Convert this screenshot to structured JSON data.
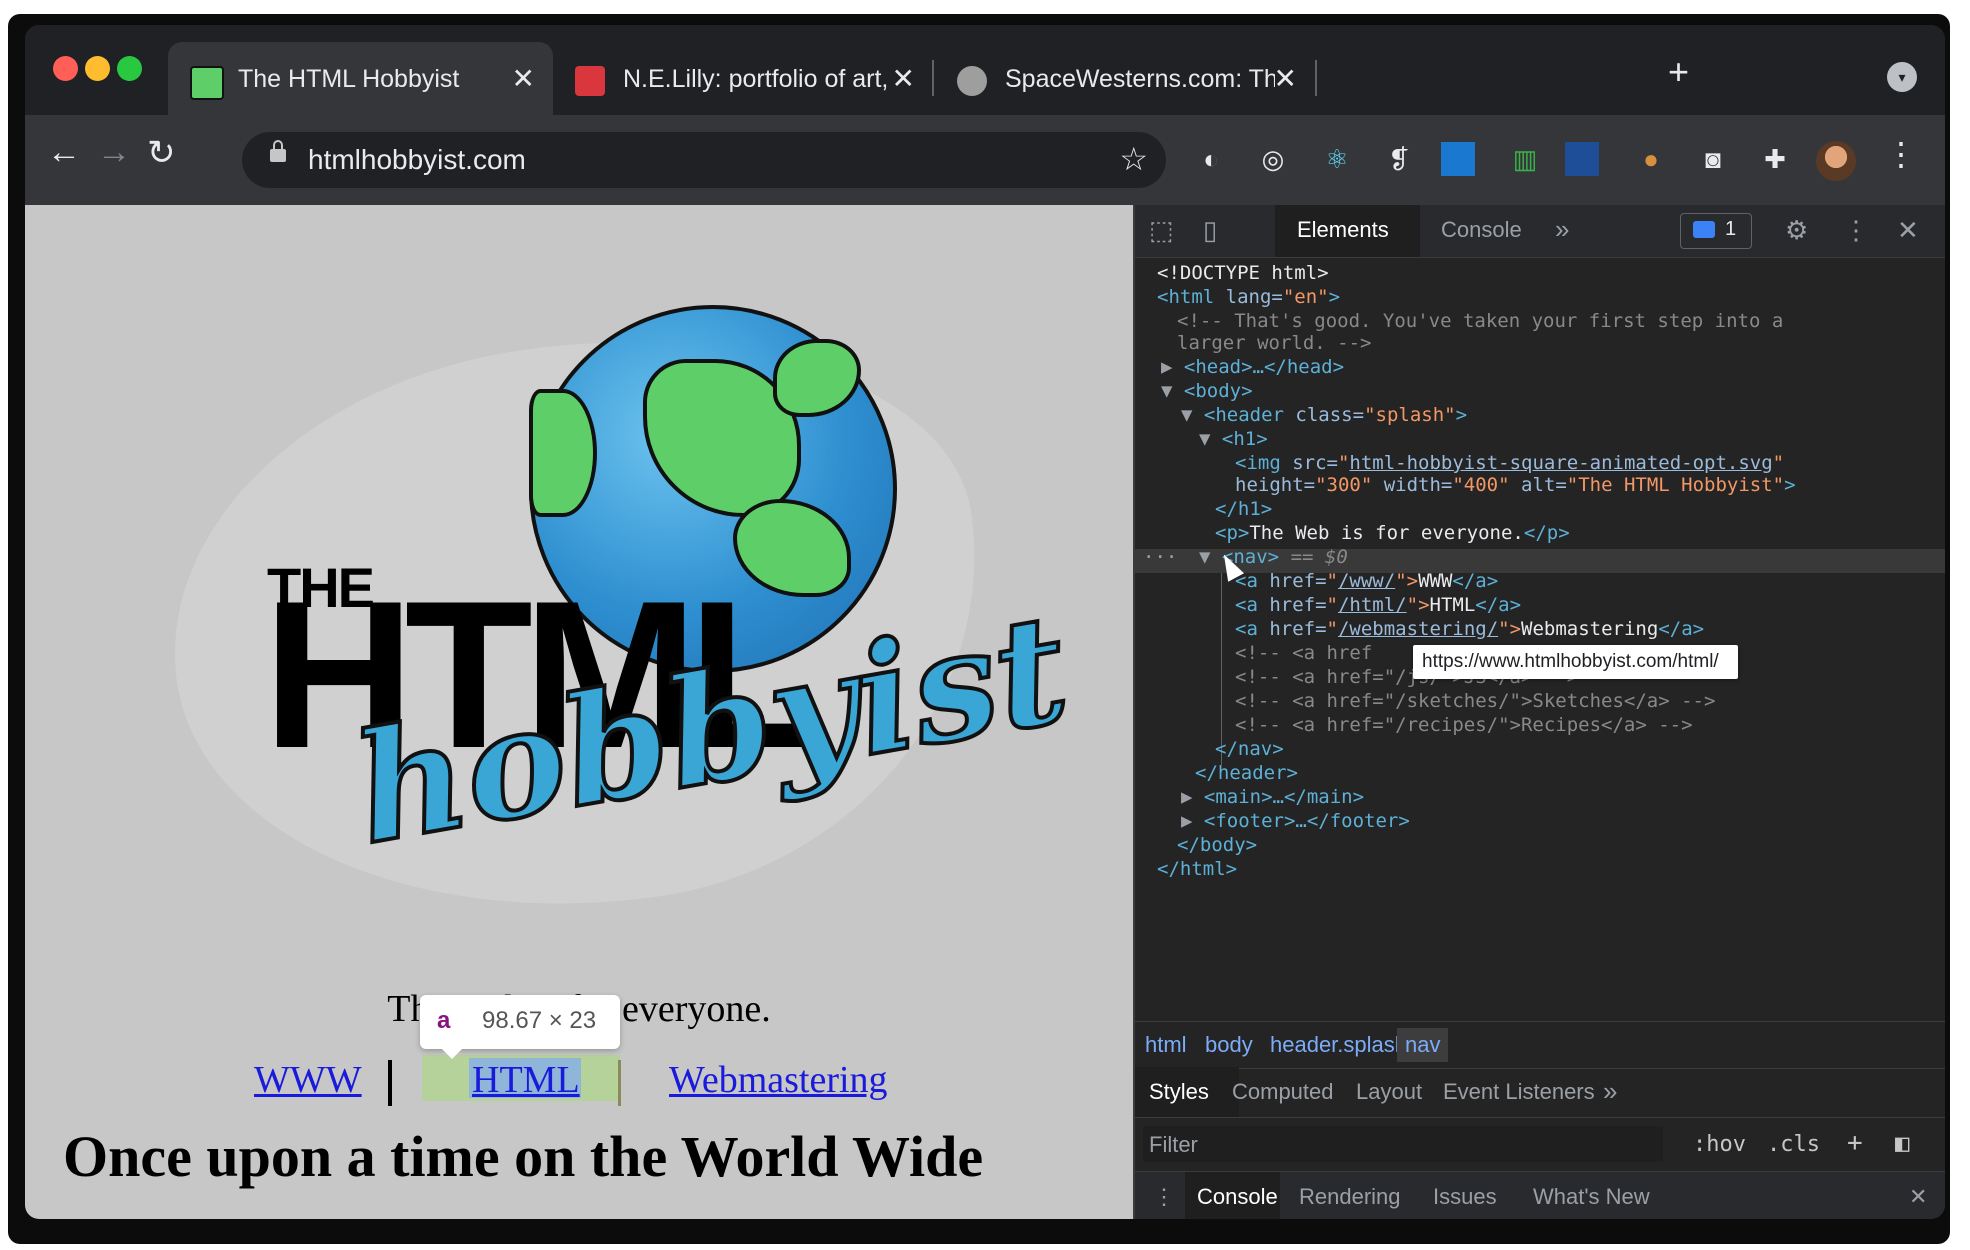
{
  "browser": {
    "tabs": [
      {
        "title": "The HTML Hobbyist",
        "active": true
      },
      {
        "title": "N.E.Lilly: portfolio of art, development",
        "active": false
      },
      {
        "title": "SpaceWesterns.com: The e-zine",
        "active": false
      }
    ],
    "new_tab": "+",
    "tab_close": "✕",
    "url": "htmlhobbyist.com"
  },
  "page": {
    "tagline": "The Web is for everyone.",
    "tooltip_tag": "a",
    "tooltip_dims": "98.67 × 23",
    "nav_links": [
      "WWW",
      "HTML",
      "Webmastering"
    ],
    "heading": "Once upon a time on the World Wide"
  },
  "devtools": {
    "tabs": [
      "Elements",
      "Console"
    ],
    "more": "»",
    "issues_count": "1",
    "selected_marker": "== $0",
    "url_tooltip": "https://www.htmlhobbyist.com/html/",
    "breadcrumbs": [
      "html",
      "body",
      "header.splash",
      "nav"
    ],
    "style_tabs": [
      "Styles",
      "Computed",
      "Layout",
      "Event Listeners"
    ],
    "filter_placeholder": "Filter",
    "hov": ":hov",
    "cls": ".cls",
    "drawer_tabs": [
      "Console",
      "Rendering",
      "Issues",
      "What's New"
    ],
    "dom": {
      "l1": "<!DOCTYPE html>",
      "l2_tag": "<html ",
      "l2_attr": "lang=",
      "l2_val": "\"en\"",
      "l2_end": ">",
      "l3": "<!-- That's good. You've taken your first step into a",
      "l4": "larger world. -->",
      "l5": "<head>…</head>",
      "l6": "<body>",
      "l7_tag": "<header ",
      "l7_attr": "class=",
      "l7_val": "\"splash\"",
      "l7_end": ">",
      "l8": "<h1>",
      "l9_tag": "<img ",
      "l9_attr": "src=",
      "l9_q1": "\"",
      "l9_link": "html-hobbyist-square-animated-opt.svg",
      "l9_q2": "\"",
      "l10_a1": "height=",
      "l10_v1": "\"300\"",
      "l10_a2": " width=",
      "l10_v2": "\"400\"",
      "l10_a3": " alt=",
      "l10_v3": "\"The HTML Hobbyist\"",
      "l10_end": ">",
      "l11": "</h1>",
      "l12_open": "<p>",
      "l12_text": "The Web is for everyone.",
      "l12_close": "</p>",
      "l13": "<nav>",
      "l14_open": "<a ",
      "l14_attr": "href=",
      "l14_q1": "\"",
      "l14_link": "/www/",
      "l14_q2": "\">",
      "l14_text": "WWW",
      "l14_close": "</a>",
      "l15_link": "/html/",
      "l15_text": "HTML",
      "l16_link": "/webmastering/",
      "l16_text": "Webmastering",
      "l17": "<!-- <a href",
      "l18": "<!-- <a href=\"/js/\">JS</a> -->",
      "l19": "<!-- <a href=\"/sketches/\">Sketches</a> -->",
      "l20": "<!-- <a href=\"/recipes/\">Recipes</a> -->",
      "l21": "</nav>",
      "l22": "</header>",
      "l23": "<main>…</main>",
      "l24": "<footer>…</footer>",
      "l25": "</body>",
      "l26": "</html>"
    }
  },
  "icons": [
    "back-icon",
    "forward-icon",
    "reload-icon",
    "lock-icon",
    "star-icon",
    "extensions-icon",
    "inspect-icon",
    "device-icon",
    "gear-icon"
  ]
}
